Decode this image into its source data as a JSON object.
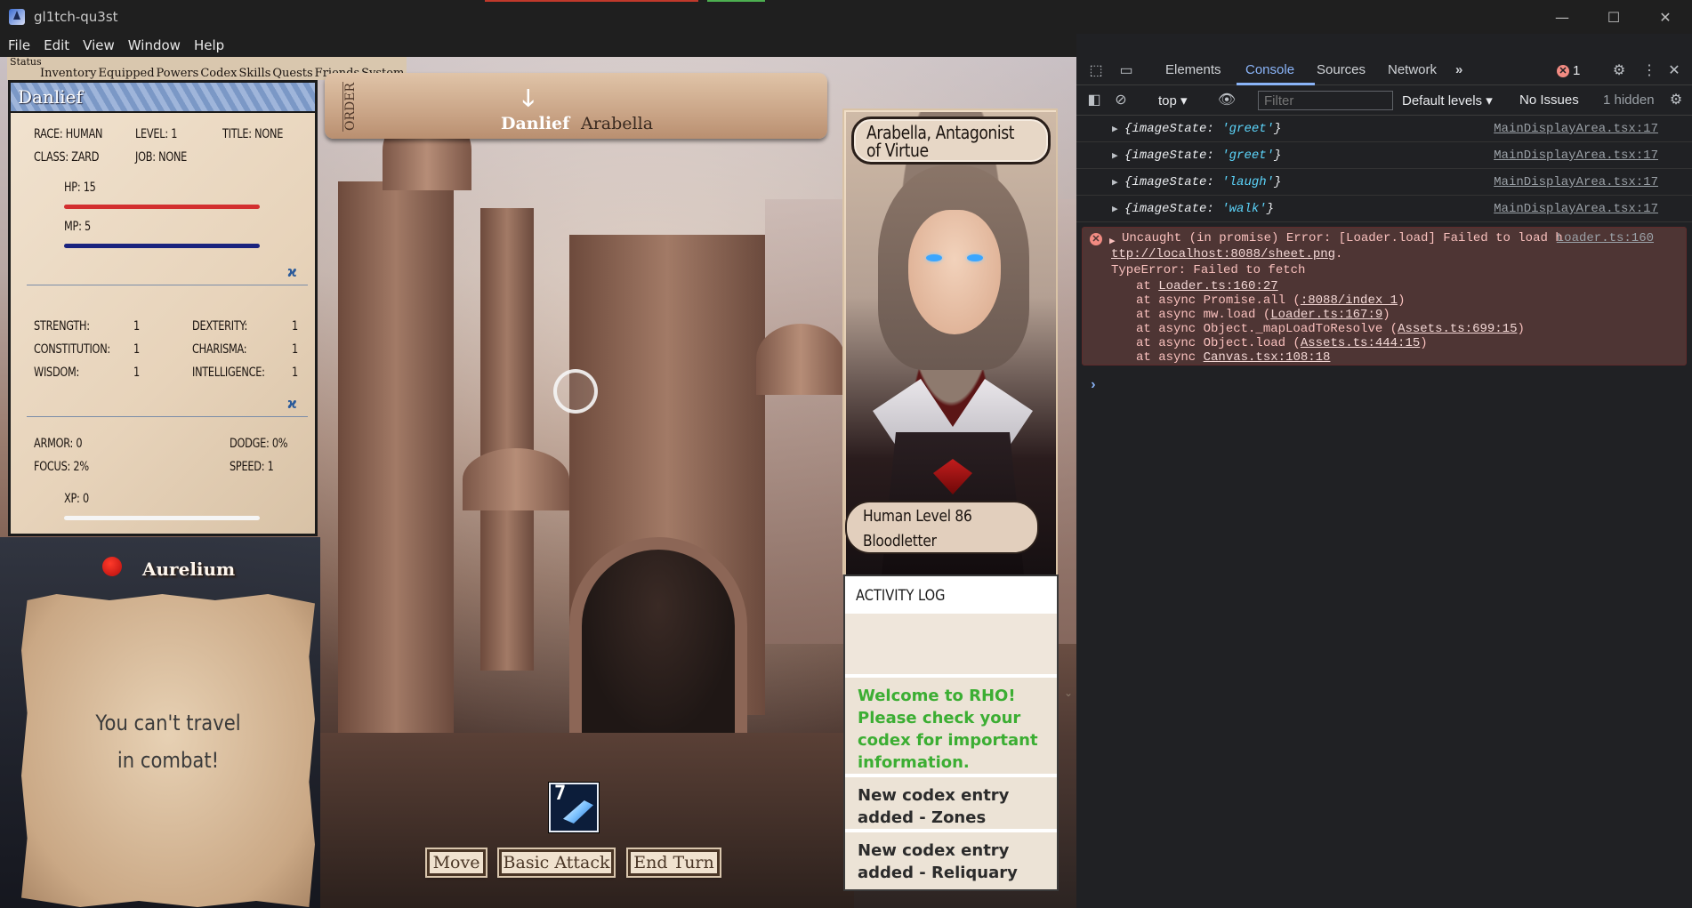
{
  "window": {
    "title": "gl1tch-qu3st",
    "controls": {
      "minimize": "—",
      "maximize": "☐",
      "close": "✕"
    }
  },
  "menu": [
    "File",
    "Edit",
    "View",
    "Window",
    "Help"
  ],
  "game": {
    "tabs": {
      "status": "Status",
      "others": [
        "Inventory",
        "Equipped",
        "Powers",
        "Codex",
        "Skills",
        "Quests",
        "Friends",
        "System"
      ]
    },
    "character": {
      "name": "Danlief",
      "race": "RACE: HUMAN",
      "level": "LEVEL: 1",
      "title": "TITLE: NONE",
      "class": "CLASS: ZARD",
      "job": "JOB: NONE",
      "hp": "HP: 15",
      "mp": "MP: 5",
      "hp_fraction": 1.0,
      "mp_fraction": 1.0,
      "xp_fraction": 0.0,
      "attributes": {
        "strength_label": "STRENGTH:",
        "strength": "1",
        "dexterity_label": "DEXTERITY:",
        "dexterity": "1",
        "constitution_label": "CONSTITUTION:",
        "constitution": "1",
        "charisma_label": "CHARISMA:",
        "charisma": "1",
        "wisdom_label": "WISDOM:",
        "wisdom": "1",
        "intelligence_label": "INTELLIGENCE:",
        "intelligence": "1"
      },
      "armor": "ARMOR: 0",
      "dodge": "DODGE: 0%",
      "focus": "FOCUS: 2%",
      "speed": "SPEED: 1",
      "xp": "XP: 0",
      "colors": {
        "hp": "#d32f2f",
        "mp": "#1a237e",
        "xp": "#f5f5f5"
      },
      "divider_icon": "swirl-icon"
    },
    "zone": {
      "name": "Aurelium",
      "indicator_color": "#e01414"
    },
    "travel_message_line1": "You can't travel",
    "travel_message_line2": "in combat!",
    "turn_order": {
      "label": "ORDER",
      "arrow_icon": "arrow-down-icon",
      "current": "Danlief",
      "next": "Arabella"
    },
    "enemy": {
      "title_line1": "Arabella, Antagonist",
      "title_line2": "of Virtue",
      "level_line": "Human Level 86",
      "class_line": "Bloodletter"
    },
    "activity_log": {
      "header": "ACTIVITY LOG",
      "entries": [
        "Welcome to RHO! Please check your codex for important information.",
        "New codex entry added - Zones",
        "New codex entry added - Reliquary"
      ]
    },
    "skill_slot": {
      "hotkey": "7",
      "icon": "slash-skill-icon"
    },
    "actions": {
      "move": "Move",
      "basic_attack": "Basic Attack",
      "end_turn": "End Turn"
    }
  },
  "devtools": {
    "tabs": [
      "Elements",
      "Console",
      "Sources",
      "Network"
    ],
    "active_tab": "Console",
    "more_tabs": "»",
    "error_count": "1",
    "context": "top",
    "filter_placeholder": "Filter",
    "levels": "Default levels",
    "issues": "No Issues",
    "hidden": "1 hidden",
    "logs": [
      {
        "key": "imageState",
        "value": "'greet'",
        "source": "MainDisplayArea.tsx:17"
      },
      {
        "key": "imageState",
        "value": "'greet'",
        "source": "MainDisplayArea.tsx:17"
      },
      {
        "key": "imageState",
        "value": "'laugh'",
        "source": "MainDisplayArea.tsx:17"
      },
      {
        "key": "imageState",
        "value": "'walk'",
        "source": "MainDisplayArea.tsx:17"
      }
    ],
    "error": {
      "message": "Uncaught (in promise) Error: [Loader.load] Failed to load h",
      "message_cont": "ttp://localhost:8088/sheet.png",
      "source": "Loader.ts:160",
      "type": "TypeError: Failed to fetch",
      "stack": [
        {
          "prefix": "at ",
          "link": "Loader.ts:160:27",
          "suffix": ""
        },
        {
          "prefix": "at async Promise.all (",
          "link": ":8088/index 1",
          "suffix": ")"
        },
        {
          "prefix": "at async mw.load (",
          "link": "Loader.ts:167:9",
          "suffix": ")"
        },
        {
          "prefix": "at async Object._mapLoadToResolve (",
          "link": "Assets.ts:699:15",
          "suffix": ")"
        },
        {
          "prefix": "at async Object.load (",
          "link": "Assets.ts:444:15",
          "suffix": ")"
        },
        {
          "prefix": "at async ",
          "link": "Canvas.tsx:108:18",
          "suffix": ""
        }
      ]
    }
  }
}
